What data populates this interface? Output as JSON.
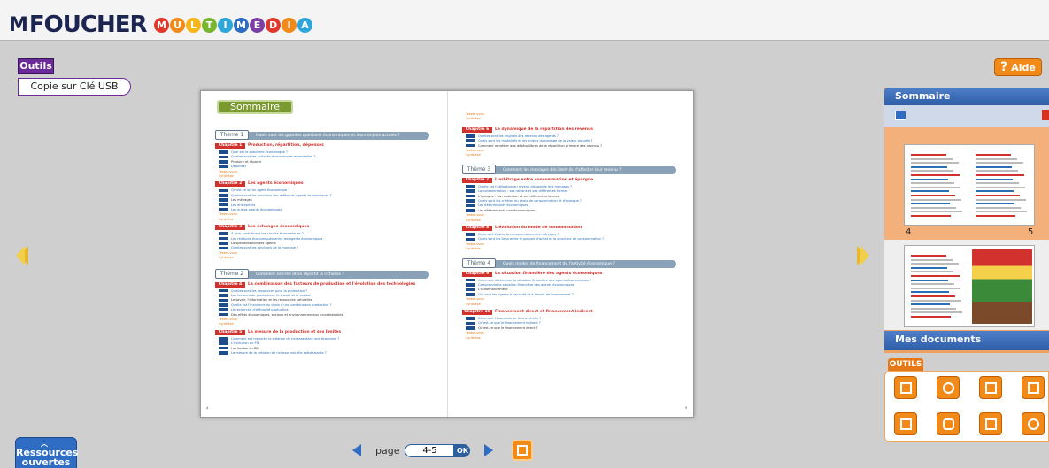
{
  "header": {
    "logo_text": "FOUCHER",
    "logo_multimedia_letters": [
      "M",
      "U",
      "L",
      "T",
      "I",
      "M",
      "E",
      "D",
      "I",
      "A"
    ],
    "logo_multimedia_colors": [
      "#e0382a",
      "#f28a1a",
      "#f7b71a",
      "#7ab530",
      "#2fa6d9",
      "#2f6cc4",
      "#7b3fa6",
      "#e0382a",
      "#f28a1a",
      "#2fa6d9"
    ]
  },
  "left_menu": {
    "outils_label": "Outils",
    "usb_label": "Copie sur Clé USB"
  },
  "aide": {
    "label": "Aide",
    "icon": "question-mark-icon"
  },
  "viewer": {
    "sommaire_title": "Sommaire",
    "left_page": {
      "theme1_tag": "Thème 1",
      "theme1_title": "Quels sont les grandes questions économiques et leurs enjeux actuels ?",
      "chap1_tag": "Chapitre 1",
      "chap1_title": "Production, répartition, dépenses",
      "chap1_lines": [
        "Quel est le problème économique ?",
        "Quelles sont les activités économiques essentielles ?",
        "Produire et répartir",
        "Dépenser",
        "Testez-vous",
        "Synthèse"
      ],
      "chap2_tag": "Chapitre 2",
      "chap2_title": "Les agents économiques",
      "chap2_lines": [
        "Qu'est-ce qu'un agent économique ?",
        "Quelles sont les fonctions des différents agents économiques ?",
        "Les ménages",
        "Les entreprises",
        "Les autres agents économiques",
        "Testez-vous",
        "Synthèse"
      ],
      "chap3_tag": "Chapitre 3",
      "chap3_title": "Les échanges économiques",
      "chap3_lines": [
        "À quoi contribuent les circuits économiques ?",
        "Les relations économiques entre les agents économiques",
        "La spécialisation des agents",
        "Quelles sont les fonctions de la monnaie ?",
        "Testez-vous",
        "Synthèse"
      ],
      "theme2_tag": "Thème 2",
      "theme2_title": "Comment se crée et se répartit la richesse ?",
      "chap4_tag": "Chapitre 4",
      "chap4_title": "La combinaison des facteurs de production et l'évolution des technologies",
      "chap4_lines": [
        "Quelles sont les ressources pour la production ?",
        "Les facteurs de production : le travail et le capital",
        "Le savoir, l'information et les ressources naturelles",
        "Quelle est l'incidence du choix d'une combinaison productive ?",
        "La recherche d'efficacité productive",
        "Des effets économiques, sociaux et environnementaux incontestables",
        "Testez-vous",
        "Synthèse"
      ],
      "chap5_tag": "Chapitre 5",
      "chap5_title": "La mesure de la production et ses limites",
      "chap5_lines": [
        "Comment est mesurée la création de richesse dans une économie ?",
        "L'évolution du PIB",
        "Les limites du PIB",
        "La mesure de la création de richesse est-elle satisfaisante ?"
      ],
      "page_no": "4"
    },
    "right_page": {
      "top_lines": [
        "Testez-vous",
        "Synthèse"
      ],
      "chap6_tag": "Chapitre 6",
      "chap6_title": "La dynamique de la répartition des revenus",
      "chap6_lines": [
        "Quelles sont les origines des revenus des agents ?",
        "Quels sont les modalités et les enjeux du partage de la valeur ajoutée ?",
        "Comment remédier aux déséquilibres de la répartition primaire des revenus ?",
        "Testez-vous",
        "Synthèse"
      ],
      "theme3_tag": "Thème 3",
      "theme3_title": "Comment les ménages décident-ils d'affecter leur revenu ?",
      "chap7_tag": "Chapitre 7",
      "chap7_title": "L'arbitrage entre consommation et épargne",
      "chap7_lines": [
        "Quelle est l'utilisation du revenu disponible des ménages ?",
        "La consommation : ses raisons et ses différentes formes",
        "L'épargne : son évolution et ses différentes formes",
        "Quels sont les critères du choix de consommation et d'épargne ?",
        "Les déterminants économiques",
        "Les déterminants non économiques",
        "Testez-vous",
        "Synthèse"
      ],
      "chap8_tag": "Chapitre 8",
      "chap8_title": "L'évolution du mode de consommation",
      "chap8_lines": [
        "Comment évolue la consommation des ménages ?",
        "Quels sont les liens entre le pouvoir d'achat et la structure de consommation ?",
        "Testez-vous",
        "Synthèse"
      ],
      "theme4_tag": "Thème 4",
      "theme4_title": "Quels modes de financement de l'activité économique ?",
      "chap9_tag": "Chapitre 9",
      "chap9_title": "La situation financière des agents économiques",
      "chap9_lines": [
        "Comment déterminer la situation financière des agents économiques ?",
        "Comprendre la situation financière des agents économiques",
        "L'autofinancement",
        "Qui sont les agents à capacité et à besoin de financement ?",
        "Testez-vous",
        "Synthèse"
      ],
      "chap10_tag": "Chapitre 10",
      "chap10_title": "Financement direct et financement indirect",
      "chap10_lines": [
        "Comment l'économie se finance-t-elle ?",
        "Qu'est-ce que le financement indirect ?",
        "Qu'est-ce que le financement direct ?",
        "Testez-vous",
        "Synthèse"
      ],
      "page_no": "5"
    }
  },
  "pagination": {
    "page_label": "page",
    "page_value": "4-5",
    "ok_label": "OK"
  },
  "ressources": {
    "label_line1": "Ressources",
    "label_line2": "ouvertes"
  },
  "side": {
    "sommaire_label": "Sommaire",
    "thumb_labels": [
      "4",
      "5"
    ],
    "mes_documents_label": "Mes documents",
    "outils_tab_label": "OUTILS"
  }
}
